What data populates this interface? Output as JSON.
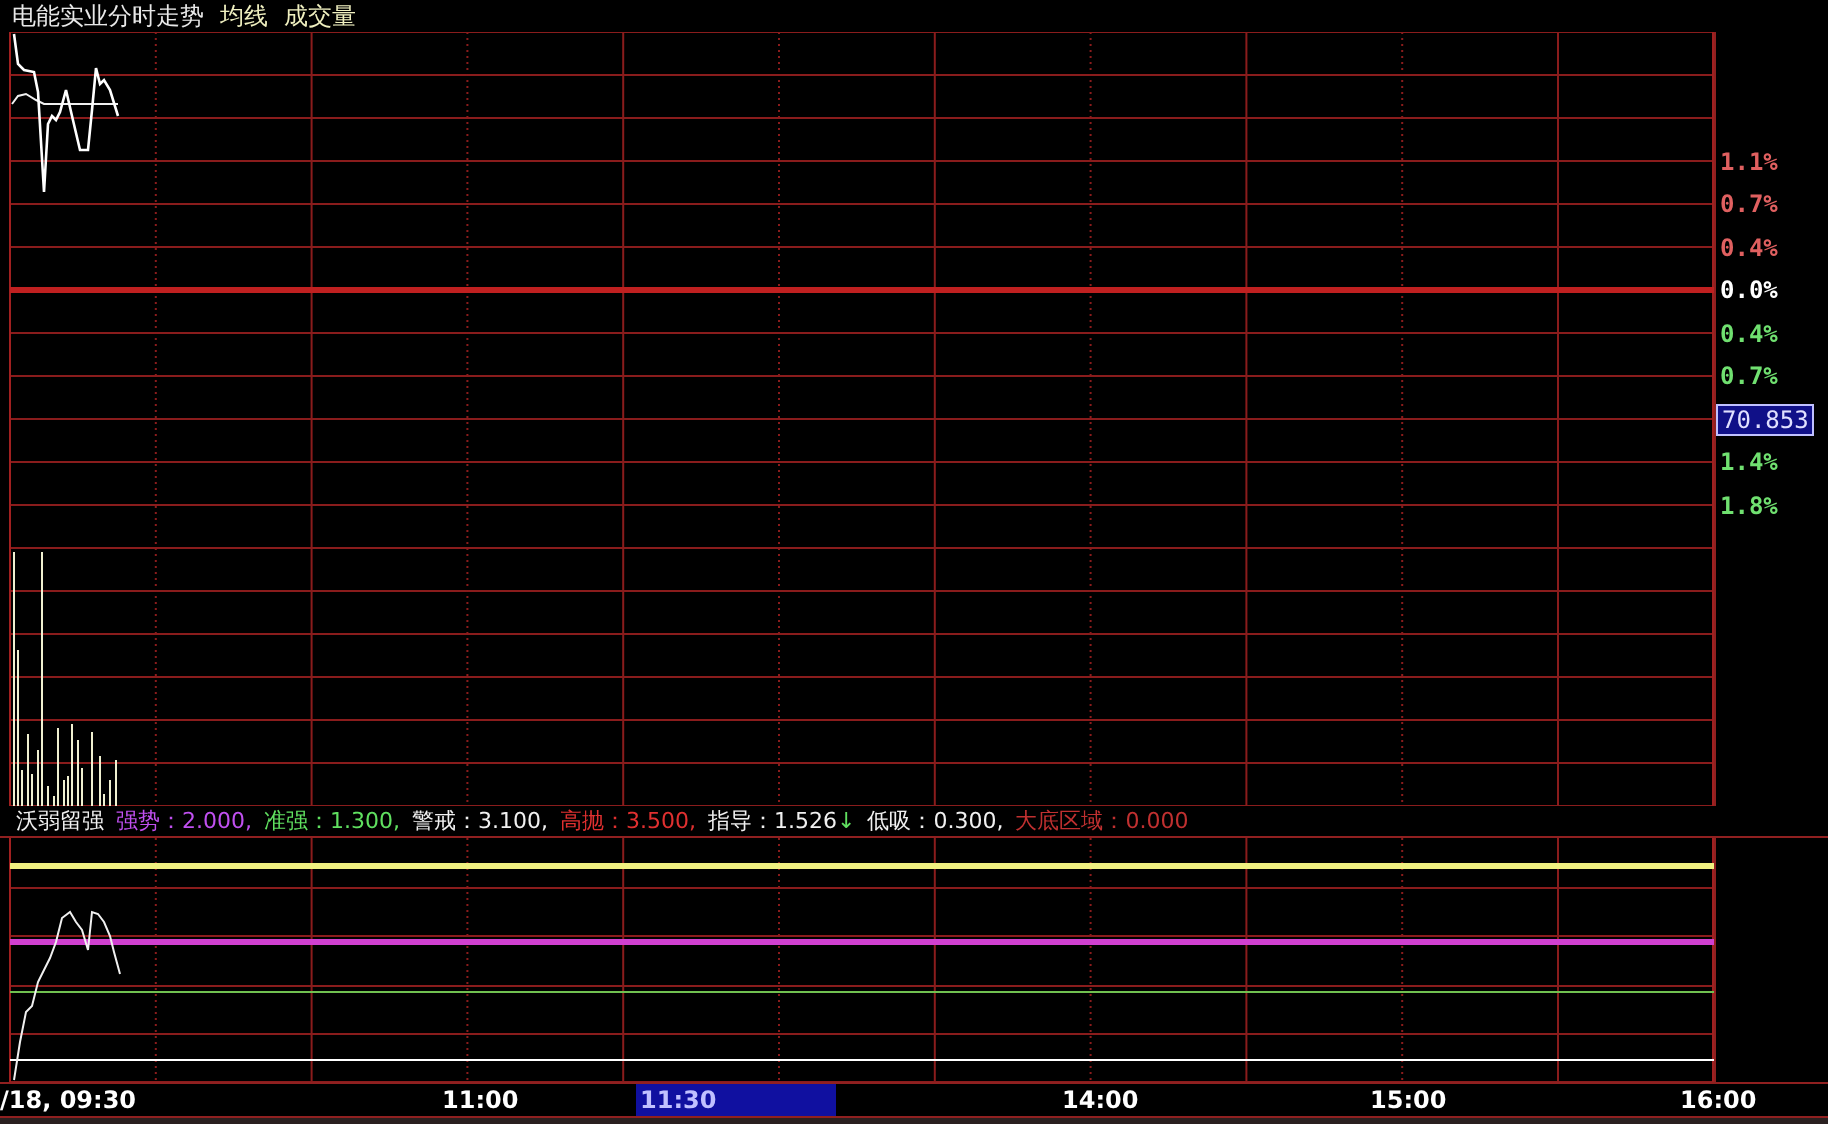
{
  "header": {
    "title": "电能实业分时走势",
    "legend": [
      "均线",
      "成交量"
    ]
  },
  "price_axis": [
    {
      "kind": "up",
      "label": "1.1%"
    },
    {
      "kind": "up",
      "label": "0.7%"
    },
    {
      "kind": "up",
      "label": "0.4%"
    },
    {
      "kind": "flat",
      "label": "0.0%"
    },
    {
      "kind": "down",
      "label": "0.4%"
    },
    {
      "kind": "down",
      "label": "0.7%"
    },
    {
      "kind": "marker",
      "label": "70.853"
    },
    {
      "kind": "down",
      "label": "1.4%"
    },
    {
      "kind": "down",
      "label": "1.8%"
    }
  ],
  "indicator": {
    "name": "沃弱留强",
    "items": [
      {
        "label": "强势：",
        "value": "2.000,",
        "color": "#c050f0"
      },
      {
        "label": "准强：",
        "value": "1.300,",
        "color": "#60e060"
      },
      {
        "label": "警戒：",
        "value": "3.100,",
        "color": "#f0f0f0"
      },
      {
        "label": "高抛：",
        "value": "3.500,",
        "color": "#e03030"
      },
      {
        "label": "指导：",
        "value": "1.526",
        "arrow": "↓",
        "color": "#f0f0f0"
      },
      {
        "label": "低吸：",
        "value": "0.300,",
        "color": "#f0f0f0"
      },
      {
        "label": "大底区域：",
        "value": "0.000",
        "color": "#c03030"
      }
    ]
  },
  "time_axis": [
    {
      "label": "/18, 09:30",
      "selected": false
    },
    {
      "label": "11:00",
      "selected": false
    },
    {
      "label": "11:30",
      "selected": true
    },
    {
      "label": "14:00",
      "selected": false
    },
    {
      "label": "15:00",
      "selected": false
    },
    {
      "label": "16:00",
      "selected": false
    }
  ]
}
